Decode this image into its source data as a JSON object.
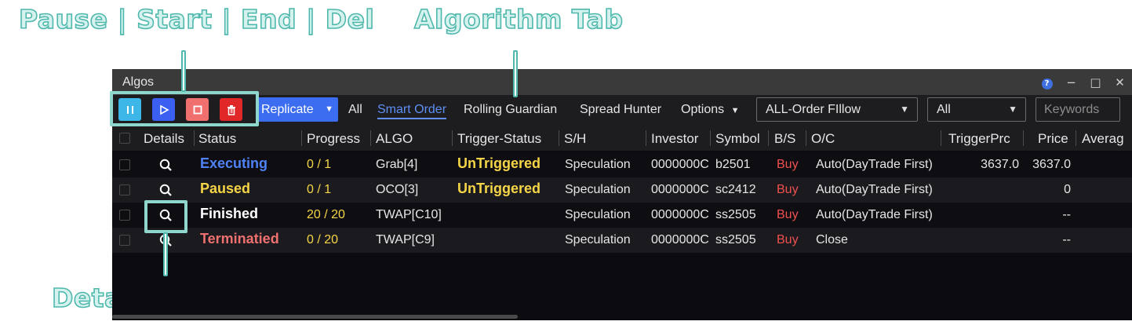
{
  "annotations": {
    "controls_label": "Pause | Start | End | Del",
    "tab_label": "Algorithm Tab",
    "details_label": "Details Window"
  },
  "window": {
    "title": "Algos",
    "help_icon": "?",
    "minimize_icon": "−",
    "maximize_icon": "□",
    "close_icon": "✕"
  },
  "toolbar": {
    "control_icons": [
      "pause-icon",
      "start-icon",
      "end-icon",
      "delete-icon"
    ],
    "control_colors": {
      "pause": "#3cb7e8",
      "start": "#3b5ff0",
      "end": "#f07070",
      "delete": "#e02828"
    },
    "replicate_label": "Replicate",
    "tabs": [
      "All",
      "Smart Order",
      "Rolling Guardian",
      "Spread Hunter"
    ],
    "active_tab": "Smart Order",
    "options_label": "Options",
    "order_filter": "ALL-Order FIllow",
    "status_filter": "All",
    "keywords_placeholder": "Keywords"
  },
  "table": {
    "columns": [
      "Details",
      "Status",
      "Progress",
      "ALGO",
      "Trigger-Status",
      "S/H",
      "Investor",
      "Symbol",
      "B/S",
      "O/C",
      "TriggerPrc",
      "Price",
      "Averag"
    ],
    "rows": [
      {
        "status": "Executing",
        "status_color": "#4f82f7",
        "progress": "0 / 1",
        "progress_color": "#f5d547",
        "algo": "Grab[4]",
        "trigger": "UnTriggered",
        "sh": "Speculation",
        "investor": "0000000C",
        "symbol": "b2501",
        "bs": "Buy",
        "oc": "Auto(DayTrade First)",
        "trigger_prc": "3637.0",
        "price": "3637.0"
      },
      {
        "status": "Paused",
        "status_color": "#f5d547",
        "progress": "0 / 1",
        "progress_color": "#f5d547",
        "algo": "OCO[3]",
        "trigger": "UnTriggered",
        "sh": "Speculation",
        "investor": "0000000C",
        "symbol": "sc2412",
        "bs": "Buy",
        "oc": "Auto(DayTrade First)",
        "trigger_prc": "",
        "price": "0"
      },
      {
        "status": "Finished",
        "status_color": "#ffffff",
        "progress": "20 / 20",
        "progress_color": "#f5d547",
        "algo": "TWAP[C10]",
        "trigger": "",
        "sh": "Speculation",
        "investor": "0000000C",
        "symbol": "ss2505",
        "bs": "Buy",
        "oc": "Auto(DayTrade First)",
        "trigger_prc": "",
        "price": "--"
      },
      {
        "status": "Terminatied",
        "status_color": "#f07070",
        "progress": "0 / 20",
        "progress_color": "#f5d547",
        "algo": "TWAP[C9]",
        "trigger": "",
        "sh": "Speculation",
        "investor": "0000000C",
        "symbol": "ss2505",
        "bs": "Buy",
        "oc": "Close",
        "trigger_prc": "",
        "price": "--"
      }
    ]
  }
}
